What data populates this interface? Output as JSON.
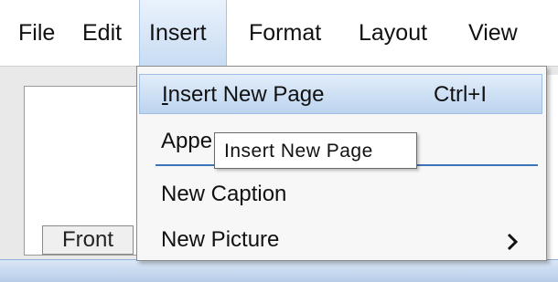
{
  "menubar": {
    "items": [
      {
        "label": "File"
      },
      {
        "label": "Edit"
      },
      {
        "label": "Insert"
      },
      {
        "label": "Format"
      },
      {
        "label": "Layout"
      },
      {
        "label": "View"
      }
    ],
    "active": "Insert"
  },
  "dropdown": {
    "items": [
      {
        "label": "Insert New Page",
        "shortcut": "Ctrl+I"
      },
      {
        "label": "Appe"
      },
      {
        "label": "New Caption"
      },
      {
        "label": "New Picture",
        "submenu_icon": "chevron-right-icon"
      }
    ]
  },
  "tooltip": {
    "text": "Insert New Page"
  },
  "canvas": {
    "tab_label": "Front"
  },
  "colors": {
    "menu_highlight": "#c8dcf3",
    "accent_blue": "#3f78c0"
  }
}
